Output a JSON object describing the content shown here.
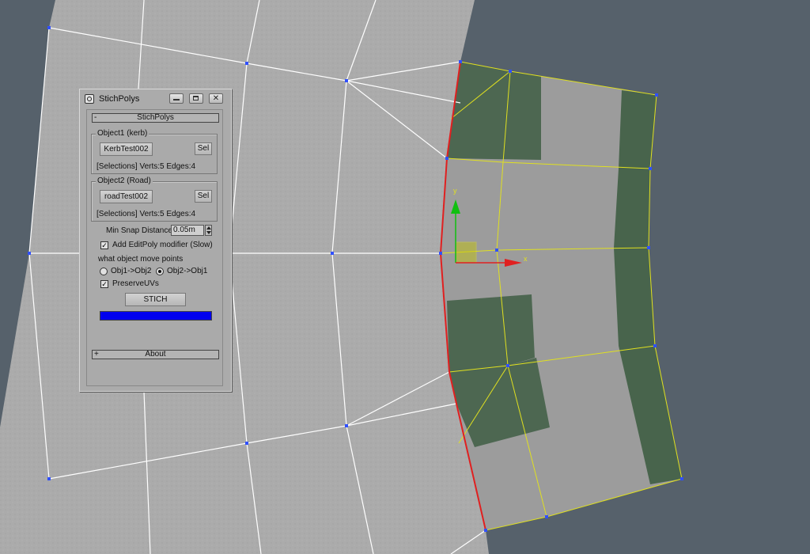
{
  "dialog": {
    "title": "StichPolys",
    "rollout_main": {
      "toggle": "-",
      "label": "StichPolys"
    },
    "object1": {
      "group_label": "Object1 (kerb)",
      "object_button": "KerbTest002",
      "sel_button": "Sel",
      "selection_info": "[Selections] Verts:5  Edges:4"
    },
    "object2": {
      "group_label": "Object2 (Road)",
      "object_button": "roadTest002",
      "sel_button": "Sel",
      "selection_info": "[Selections] Verts:5  Edges:4"
    },
    "min_snap": {
      "label": "Min Snap Distance:",
      "value": "0.05m"
    },
    "add_editpoly": {
      "label": "Add EditPoly modifier (Slow)",
      "checked": true,
      "mark": "✓"
    },
    "move_points_label": "what object move points",
    "radio_options": [
      {
        "label": "Obj1->Obj2",
        "selected": false
      },
      {
        "label": "Obj2->Obj1",
        "selected": true
      }
    ],
    "preserve_uvs": {
      "label": "PreserveUVs",
      "checked": true,
      "mark": "✓"
    },
    "stitch_button": "STICH",
    "progress": {
      "fraction": 1.0,
      "color": "#0000ee"
    },
    "rollout_about": {
      "toggle": "+",
      "label": "About"
    }
  },
  "viewport": {
    "background": "#56616b",
    "gizmo_axes": {
      "x_label": "x",
      "y_label": "y"
    },
    "colors": {
      "road": "#ababab",
      "kerb_green": "#3f5e44",
      "wire_white": "#ffffff",
      "wire_yellow": "#e0e020",
      "edge_red": "#e02020",
      "vertex": "#3050ff"
    }
  }
}
